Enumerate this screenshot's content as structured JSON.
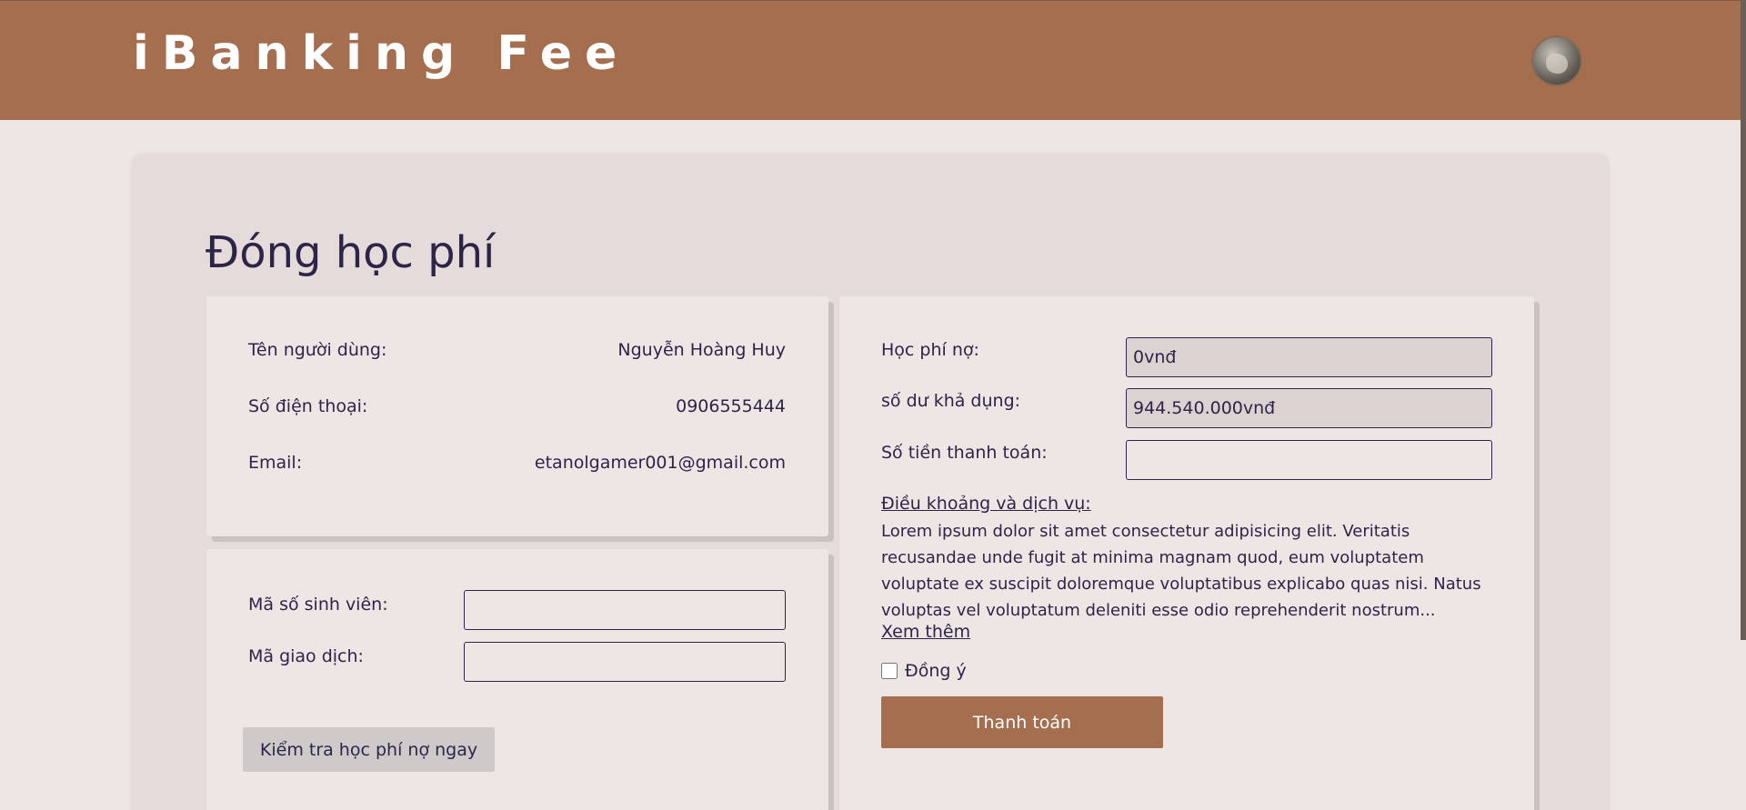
{
  "header": {
    "brand": "iBanking Fee",
    "colors": {
      "bar": "#a56f4f",
      "text": "#ffffff"
    }
  },
  "page": {
    "title": "Đóng học phí"
  },
  "user_info": {
    "name_label": "Tên người dùng:",
    "name_value": "Nguyễn Hoàng Huy",
    "phone_label": "Số điện thoại:",
    "phone_value": "0906555444",
    "email_label": "Email:",
    "email_value": "etanolgamer001@gmail.com"
  },
  "lookup": {
    "student_id_label": "Mã số sinh viên:",
    "student_id_value": "",
    "transaction_label": "Mã giao dịch:",
    "transaction_value": "",
    "check_button": "Kiểm tra học phí nợ ngay"
  },
  "payment": {
    "debt_label": "Học phí nợ:",
    "debt_value": "0vnđ",
    "balance_label": "số dư khả dụng:",
    "balance_value": "944.540.000vnđ",
    "amount_label": "Số tiền thanh toán:",
    "amount_value": "",
    "terms_link": "Điều khoảng và dịch vụ:",
    "terms_text": "Lorem ipsum dolor sit amet consectetur adipisicing elit. Veritatis recusandae unde fugit at minima magnam quod, eum voluptatem voluptate ex suscipit doloremque voluptatibus explicabo quas nisi. Natus voluptas vel voluptatum deleniti esse odio reprehenderit nostrum...",
    "more_link": "Xem thêm",
    "agree_label": "Đồng ý",
    "agree_checked": false,
    "pay_button": "Thanh toán"
  }
}
